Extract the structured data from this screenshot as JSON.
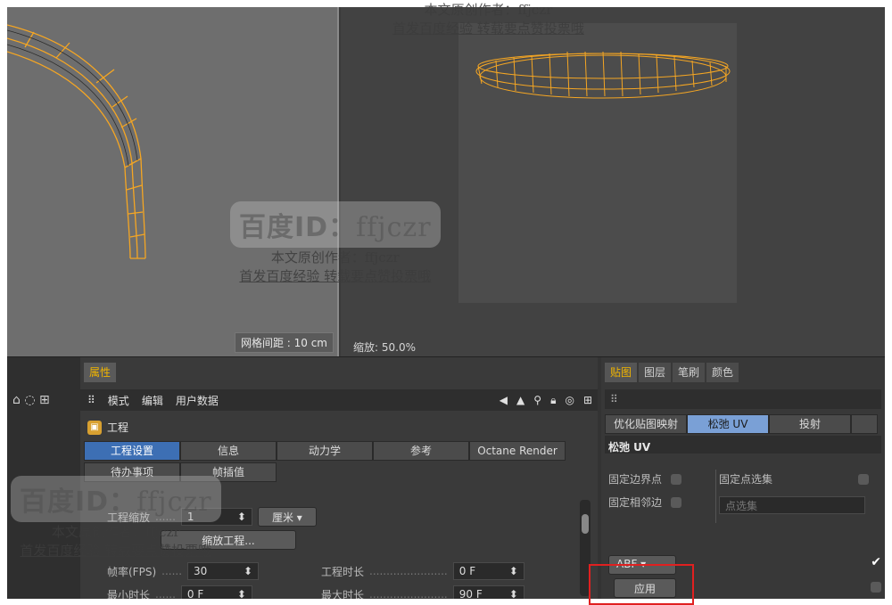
{
  "viewports": {
    "grid_spacing": "网格间距 : 10 cm",
    "zoom": "缩放: 50.0%"
  },
  "watermarks": [
    {
      "title_bold": "百度ID：",
      "title_id": "ffjczr",
      "line2": "本文原创作者：ffjczr",
      "line3": "首发百度经验  转载要点赞投票哦"
    }
  ],
  "attributes": {
    "tab": "属性",
    "menu": [
      "模式",
      "编辑",
      "用户数据"
    ],
    "project_title": "工程",
    "tabs": [
      "工程设置",
      "信息",
      "动力学",
      "参考",
      "Octane Render"
    ],
    "tabs2": [
      "待办事项",
      "帧插值"
    ],
    "scale_label": "工程缩放",
    "scale_value": "1",
    "scale_unit": "厘米",
    "scale_button": "缩放工程...",
    "fps_label": "帧率(FPS)",
    "fps_value": "30",
    "proj_len_label": "工程时长",
    "proj_len_value": "0 F",
    "min_len_label": "最小时长",
    "min_len_value": "0 F",
    "max_len_label": "最大时长",
    "max_len_value": "90 F"
  },
  "texture_panel": {
    "tabs": [
      "贴图",
      "图层",
      "笔刷",
      "颜色"
    ],
    "subtabs": [
      "优化贴图映射",
      "松弛 UV",
      "投射"
    ],
    "section": "松弛 UV",
    "fix_border": "固定边界点",
    "fix_neighbor": "固定相邻边",
    "fix_selection": "固定点选集",
    "point_selection": "点选集",
    "method": "ABF",
    "apply": "应用"
  },
  "colors": {
    "accent": "#f0b400",
    "tab_active": "#3d6fb4",
    "highlight": "#e02020",
    "mesh": "#f5a623"
  }
}
